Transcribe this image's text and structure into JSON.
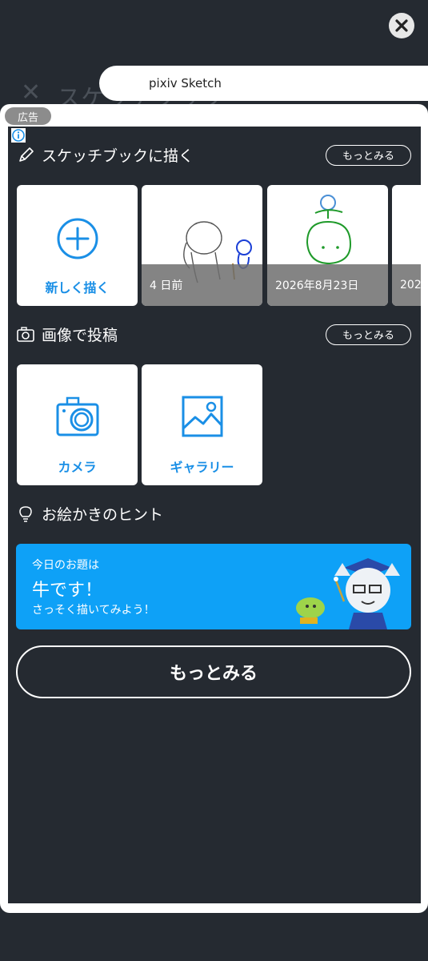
{
  "background": {
    "title": "スケッチブック"
  },
  "browser": {
    "url_title": "pixiv Sketch"
  },
  "ad": {
    "badge": "広告"
  },
  "sketchbook": {
    "title": "スケッチブックに描く",
    "more": "もっとみる",
    "new_label": "新しく描く",
    "thumbs": [
      {
        "caption": "4 日前"
      },
      {
        "caption": "2026年8月23日"
      },
      {
        "caption": "202"
      }
    ]
  },
  "post": {
    "title": "画像で投稿",
    "more": "もっとみる",
    "camera": "カメラ",
    "gallery": "ギャラリー"
  },
  "hint": {
    "title": "お絵かきのヒント",
    "line1": "今日のお題は",
    "line2": "牛です！",
    "line3": "さっそく描いてみよう！"
  },
  "more_button": "もっとみる",
  "colors": {
    "accent": "#1a8fe6",
    "banner": "#0ea1f7",
    "background": "#252a31"
  }
}
